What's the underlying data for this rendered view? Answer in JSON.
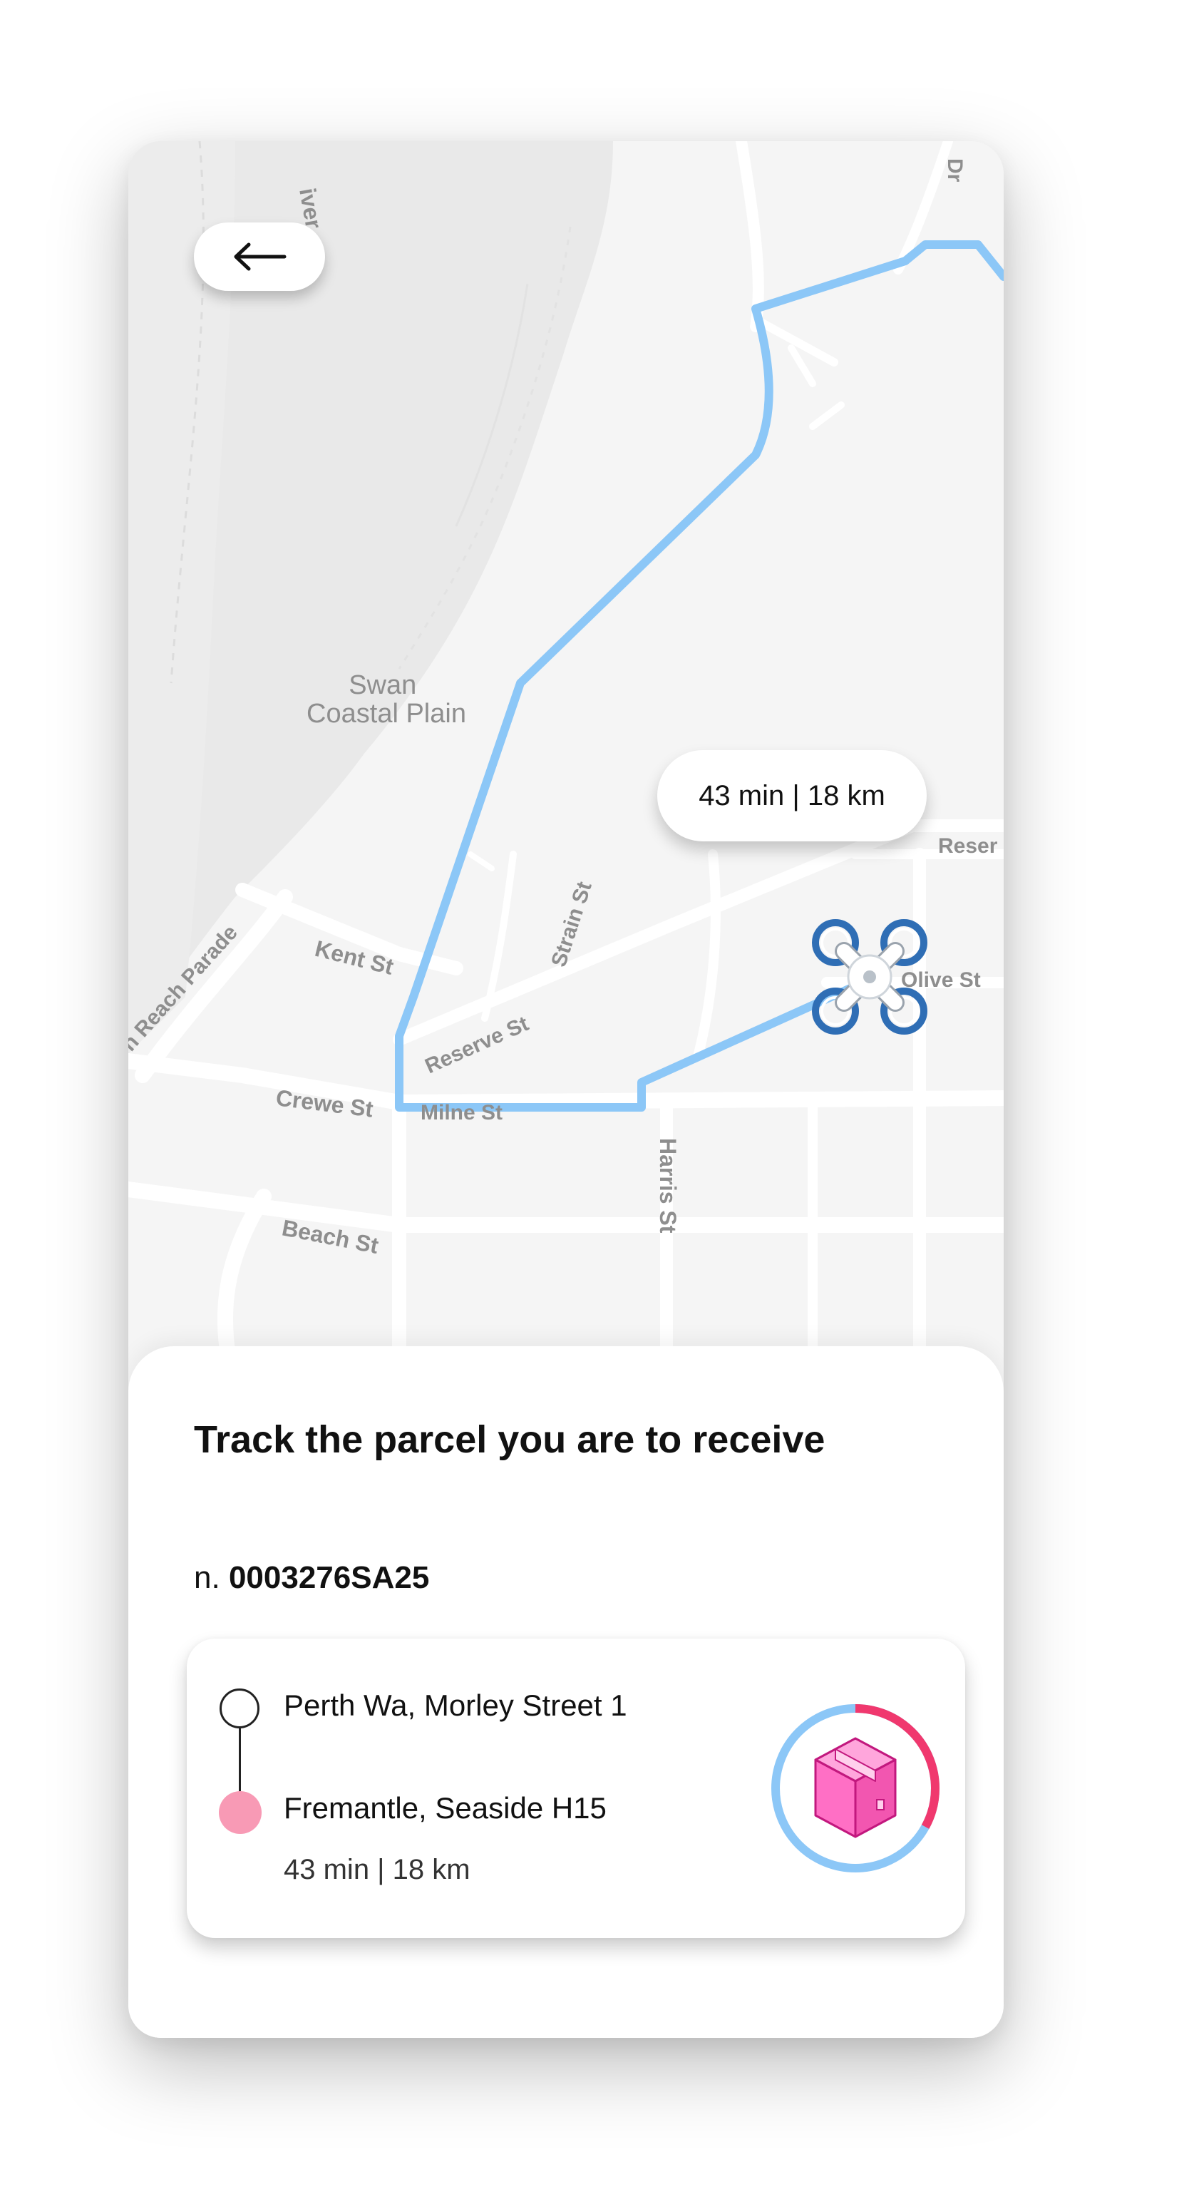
{
  "header": {
    "back_label": "back"
  },
  "map": {
    "labels": {
      "area": [
        "Swan",
        "Coastal Plain"
      ],
      "kent": "Kent St",
      "crewe": "Crewe St",
      "beach": "Beach St",
      "reserve": "Reserve St",
      "strain": "Strain St",
      "harris": "Harris St",
      "olive": "Olive St",
      "parade": "n Reach Parade",
      "milne": "Milne St",
      "reser": "Reser",
      "river": "iver",
      "dr": "Dr"
    },
    "eta_pill": "43 min | 18 km"
  },
  "sheet": {
    "title": "Track the parcel you are to receive",
    "parcel_prefix": "n.",
    "parcel_number": "0003276SA25",
    "route": {
      "from": "Perth Wa, Morley Street 1",
      "to": "Fremantle, Seaside H15",
      "meta": "43 min | 18 km"
    },
    "progress_fraction": 0.33
  },
  "colors": {
    "route": "#8cc7f7",
    "drone": "#2f6eb5",
    "progress_done": "#f0386e",
    "progress_remaining": "#8cc7f7",
    "box": "#ff6fc5",
    "destination_dot": "#f89ab5"
  }
}
